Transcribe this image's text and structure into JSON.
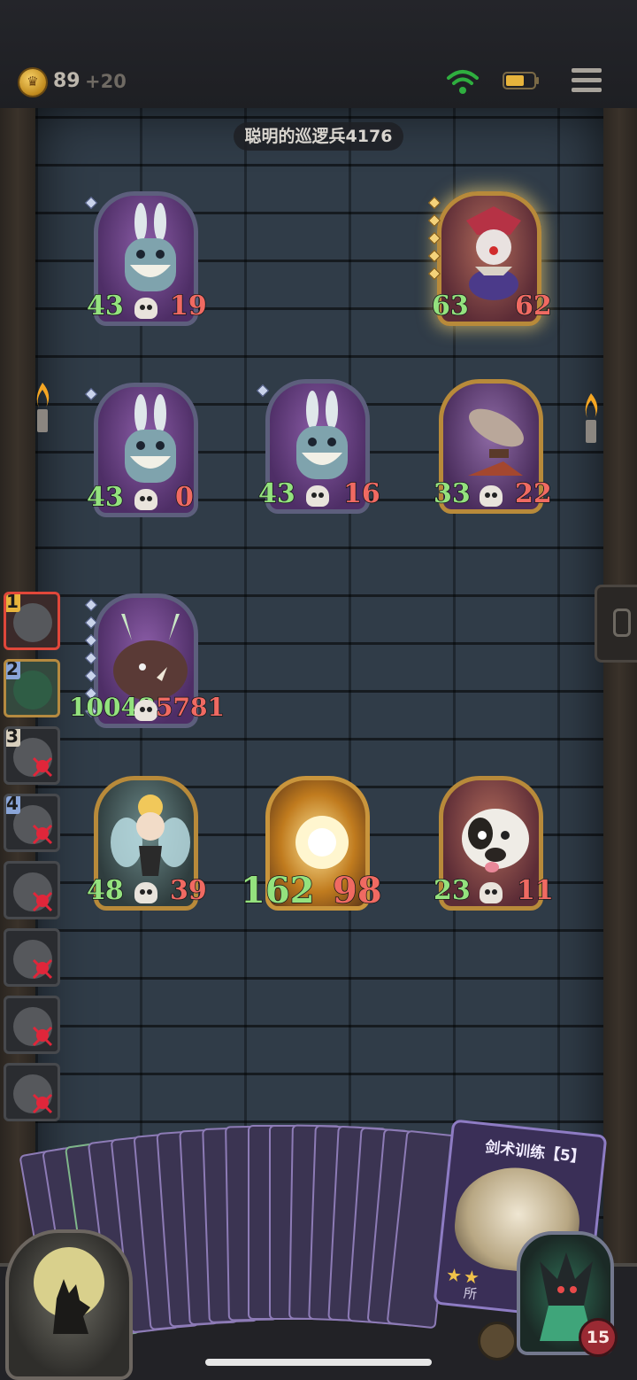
{
  "topbar": {
    "coins": "89",
    "coin_bonus": "+20",
    "coin_glyph": "♛"
  },
  "enemy": {
    "name": "聪明的巡逻兵4176"
  },
  "board": {
    "enemy_cards": [
      {
        "name": "bunny-monster",
        "atk": "43",
        "hp": "19",
        "rarity": "purple"
      },
      {
        "name": "clown",
        "atk": "63",
        "hp": "62",
        "rarity": "gold"
      },
      {
        "name": "bunny-monster",
        "atk": "43",
        "hp": "0",
        "rarity": "purple"
      },
      {
        "name": "bunny-monster",
        "atk": "43",
        "hp": "16",
        "rarity": "purple"
      },
      {
        "name": "airship",
        "atk": "33",
        "hp": "22",
        "rarity": "gold"
      }
    ],
    "player_cards": [
      {
        "name": "boar-beast",
        "atk": "10048",
        "hp": "5781",
        "rarity": "purple"
      },
      {
        "name": "fairy",
        "atk": "48",
        "hp": "39",
        "rarity": "gold"
      },
      {
        "name": "glowing-lantern",
        "atk": "162",
        "hp": "98",
        "rarity": "gold"
      },
      {
        "name": "cow-dog",
        "atk": "23",
        "hp": "11",
        "rarity": "gold"
      }
    ]
  },
  "queue": [
    {
      "num": "1",
      "state": "active"
    },
    {
      "num": "2",
      "state": "alive"
    },
    {
      "num": "3",
      "state": "dead"
    },
    {
      "num": "4",
      "state": "dead"
    },
    {
      "num": "",
      "state": "dead"
    },
    {
      "num": "",
      "state": "dead"
    },
    {
      "num": "",
      "state": "dead"
    },
    {
      "num": "",
      "state": "dead"
    }
  ],
  "hand": {
    "featured_title": "剑术训练【5】",
    "featured_stars": "★★",
    "featured_desc": "所"
  },
  "hero": {
    "hp": "15"
  },
  "colors": {
    "attack": "#94e27e",
    "health": "#f06a62",
    "board": "#303c48"
  }
}
